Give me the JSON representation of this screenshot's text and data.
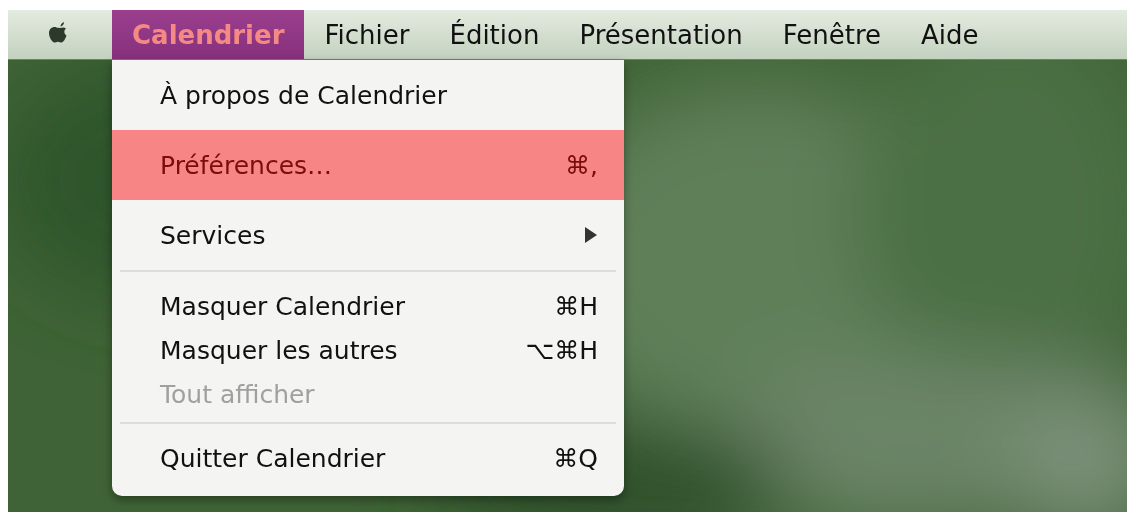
{
  "menubar": {
    "items": [
      {
        "label": "Calendrier",
        "selected": true
      },
      {
        "label": "Fichier",
        "selected": false
      },
      {
        "label": "Édition",
        "selected": false
      },
      {
        "label": "Présentation",
        "selected": false
      },
      {
        "label": "Fenêtre",
        "selected": false
      },
      {
        "label": "Aide",
        "selected": false
      }
    ]
  },
  "menu": {
    "groups": [
      {
        "items": [
          {
            "label": "À propos de Calendrier",
            "selected": false,
            "disabled": false,
            "submenu": false
          },
          {
            "label": "Préférences…",
            "shortcut": "⌘,",
            "selected": true,
            "disabled": false,
            "submenu": false
          },
          {
            "label": "Services",
            "selected": false,
            "disabled": false,
            "submenu": true
          }
        ]
      },
      {
        "items": [
          {
            "label": "Masquer Calendrier",
            "shortcut": "⌘H",
            "selected": false,
            "disabled": false,
            "submenu": false
          },
          {
            "label": "Masquer les autres",
            "shortcut": "⌥⌘H",
            "selected": false,
            "disabled": false,
            "submenu": false
          },
          {
            "label": "Tout afficher",
            "selected": false,
            "disabled": true,
            "submenu": false
          }
        ]
      },
      {
        "items": [
          {
            "label": "Quitter Calendrier",
            "shortcut": "⌘Q",
            "selected": false,
            "disabled": false,
            "submenu": false
          }
        ]
      }
    ]
  }
}
